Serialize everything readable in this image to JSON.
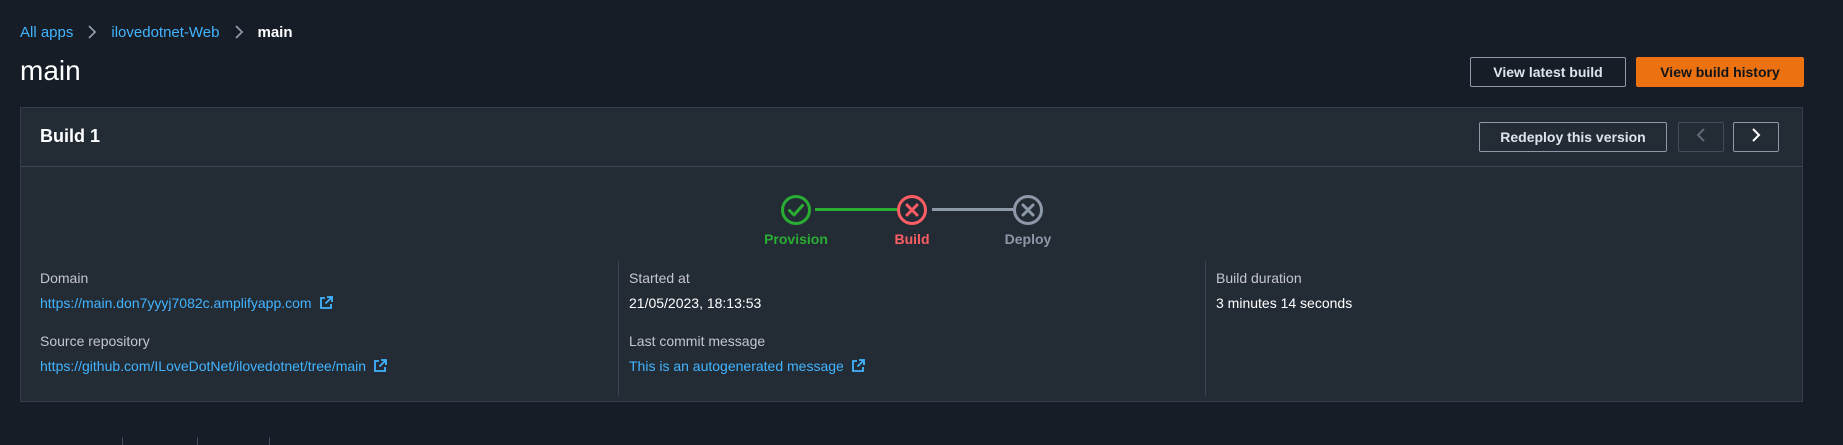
{
  "breadcrumb": {
    "items": [
      {
        "label": "All apps"
      },
      {
        "label": "ilovedotnet-Web"
      },
      {
        "label": "main"
      }
    ]
  },
  "header": {
    "title": "main",
    "view_latest_label": "View latest build",
    "view_history_label": "View build history"
  },
  "build": {
    "title": "Build 1",
    "redeploy_label": "Redeploy this version",
    "steps": [
      {
        "label": "Provision",
        "status": "success",
        "color": "#29ad32",
        "icon": "check-circle-icon"
      },
      {
        "label": "Build",
        "status": "failed",
        "color": "#ff5d64",
        "icon": "x-circle-icon"
      },
      {
        "label": "Deploy",
        "status": "canceled",
        "color": "#8d99a8",
        "icon": "x-circle-icon"
      }
    ],
    "domain": {
      "label": "Domain",
      "value": "https://main.don7yyyj7082c.amplifyapp.com"
    },
    "source_repository": {
      "label": "Source repository",
      "value": "https://github.com/ILoveDotNet/ilovedotnet/tree/main"
    },
    "started_at": {
      "label": "Started at",
      "value": "21/05/2023, 18:13:53"
    },
    "last_commit": {
      "label": "Last commit message",
      "value": "This is an autogenerated message"
    },
    "duration": {
      "label": "Build duration",
      "value": "3 minutes 14 seconds"
    }
  },
  "colors": {
    "accent": "#ec7211",
    "link": "#42b4ff",
    "success": "#29ad32",
    "error": "#ff5d64",
    "neutral": "#8d99a8"
  }
}
